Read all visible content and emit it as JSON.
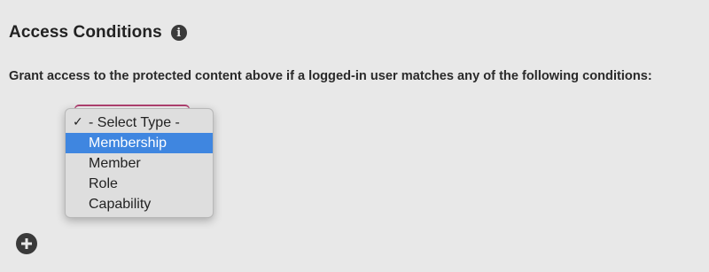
{
  "section": {
    "title": "Access Conditions",
    "info_icon": "info-icon",
    "description": "Grant access to the protected content above if a logged-in user matches any of the following conditions:"
  },
  "type_select": {
    "selected_value": "- Select Type -",
    "options": [
      {
        "label": "- Select Type -",
        "checked": true
      },
      {
        "label": "Membership",
        "highlighted": true
      },
      {
        "label": "Member"
      },
      {
        "label": "Role"
      },
      {
        "label": "Capability"
      }
    ],
    "accent_color": "#b04070",
    "highlight_color": "#3f86e0"
  },
  "add_condition": {
    "icon": "plus-circle-icon"
  }
}
